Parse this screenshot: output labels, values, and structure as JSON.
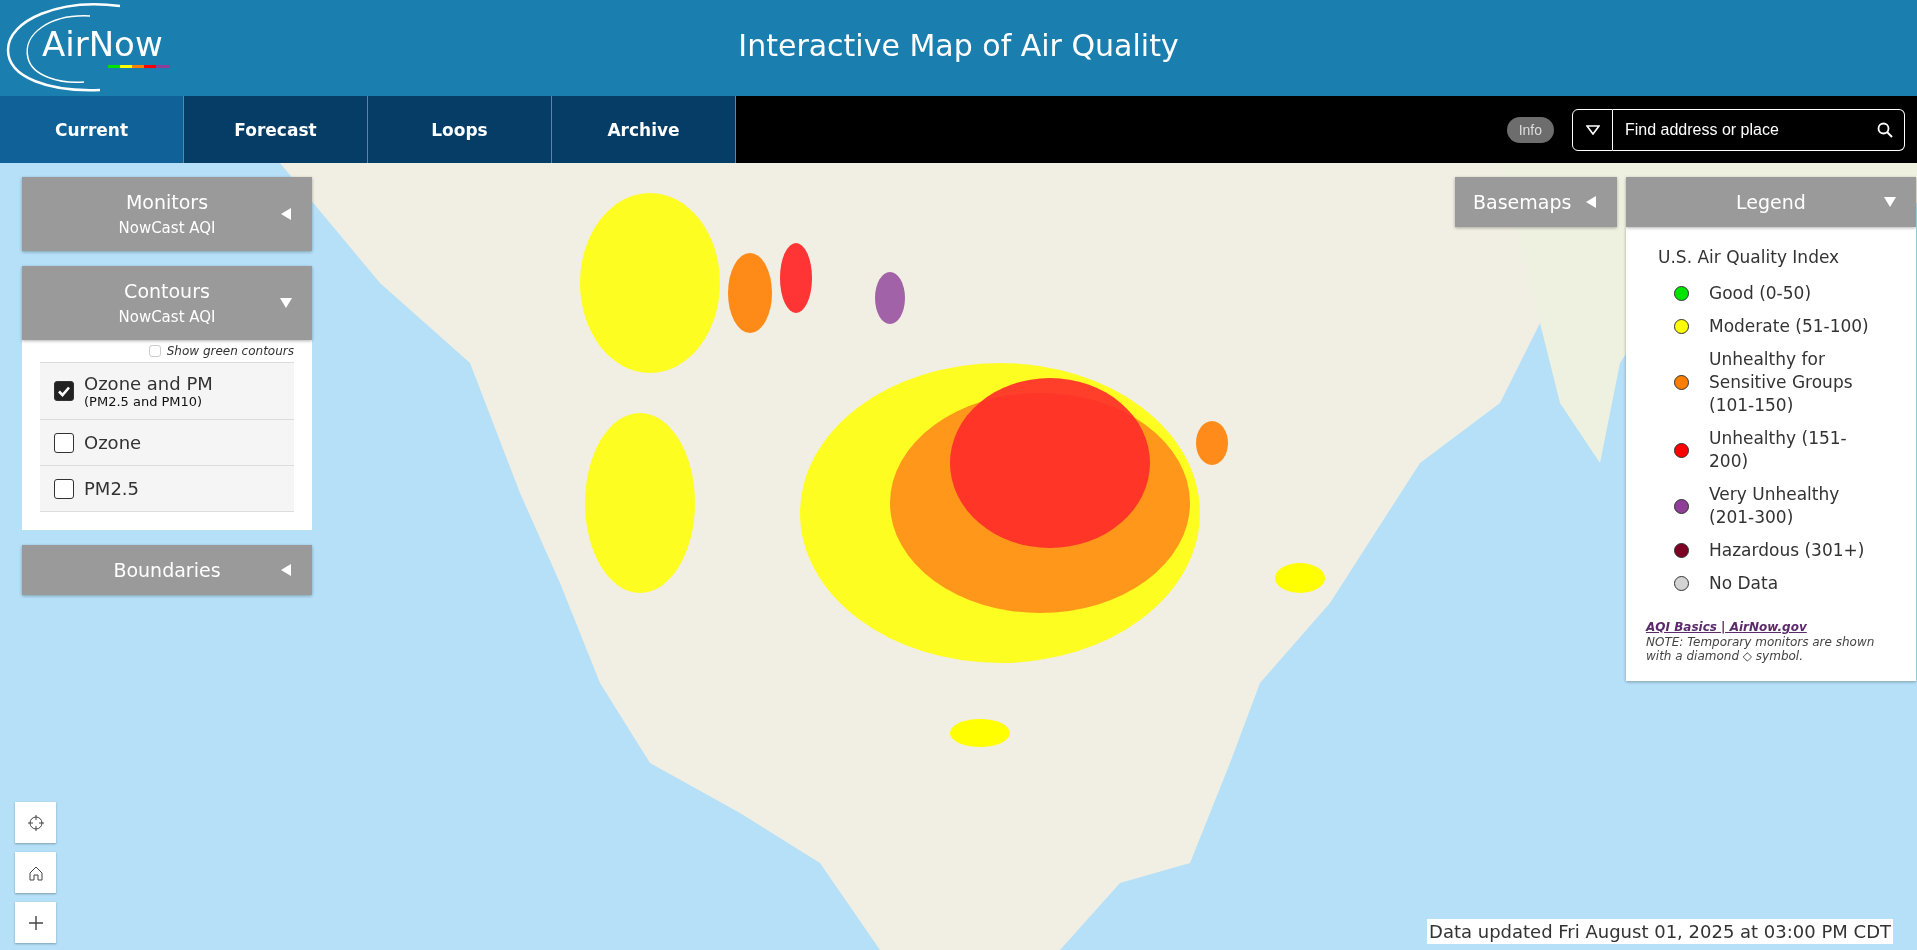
{
  "header": {
    "logo": "AirNow",
    "title": "Interactive Map of Air Quality"
  },
  "tabs": [
    {
      "label": "Current",
      "selected": true
    },
    {
      "label": "Forecast",
      "selected": false
    },
    {
      "label": "Loops",
      "selected": false
    },
    {
      "label": "Archive",
      "selected": false
    }
  ],
  "info_button": "Info",
  "search": {
    "placeholder": "Find address or place"
  },
  "left_panels": [
    {
      "title": "Monitors",
      "subtitle": "NowCast AQI",
      "expanded": false
    },
    {
      "title": "Contours",
      "subtitle": "NowCast AQI",
      "expanded": true,
      "show_green_contours": {
        "label": "Show green contours",
        "checked": false
      },
      "options": [
        {
          "label": "Ozone and PM",
          "sublabel": "(PM2.5 and PM10)",
          "checked": true
        },
        {
          "label": "Ozone",
          "checked": false
        },
        {
          "label": "PM2.5",
          "checked": false
        }
      ]
    },
    {
      "title": "Boundaries",
      "expanded": false
    }
  ],
  "basemaps": {
    "title": "Basemaps",
    "expanded": false
  },
  "legend": {
    "title": "Legend",
    "expanded": true,
    "heading": "U.S. Air Quality Index",
    "items": [
      {
        "label": "Good (0-50)",
        "color": "#00e400"
      },
      {
        "label": "Moderate (51-100)",
        "color": "#ffff00"
      },
      {
        "label": "Unhealthy for Sensitive Groups (101-150)",
        "color": "#ff7e00"
      },
      {
        "label": "Unhealthy (151-200)",
        "color": "#ff0000"
      },
      {
        "label": "Very Unhealthy (201-300)",
        "color": "#8f3f97"
      },
      {
        "label": "Hazardous (301+)",
        "color": "#7e0023"
      },
      {
        "label": "No Data",
        "color": "#d3d3d3"
      }
    ],
    "link": "AQI Basics | AirNow.gov",
    "note": "NOTE: Temporary monitors are shown with a diamond ◇ symbol."
  },
  "status": "Data updated Fri August 01, 2025 at 03:00 PM CDT"
}
